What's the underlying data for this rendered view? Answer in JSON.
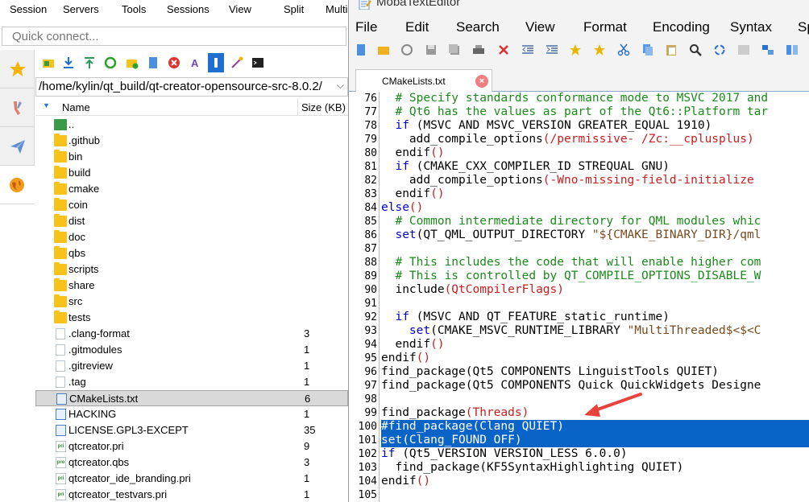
{
  "left": {
    "menu": [
      "Session",
      "Servers",
      "Tools",
      "Sessions",
      "View",
      "Split",
      "Multi"
    ],
    "quick_connect_placeholder": "Quick connect...",
    "path": "/home/kylin/qt_build/qt-creator-opensource-src-8.0.2/",
    "columns": {
      "name": "Name",
      "size": "Size (KB)"
    },
    "files": [
      {
        "name": "..",
        "size": "",
        "icon": "updir"
      },
      {
        "name": ".github",
        "size": "",
        "icon": "folder"
      },
      {
        "name": "bin",
        "size": "",
        "icon": "folder"
      },
      {
        "name": "build",
        "size": "",
        "icon": "folder"
      },
      {
        "name": "cmake",
        "size": "",
        "icon": "folder"
      },
      {
        "name": "coin",
        "size": "",
        "icon": "folder"
      },
      {
        "name": "dist",
        "size": "",
        "icon": "folder"
      },
      {
        "name": "doc",
        "size": "",
        "icon": "folder"
      },
      {
        "name": "qbs",
        "size": "",
        "icon": "folder"
      },
      {
        "name": "scripts",
        "size": "",
        "icon": "folder"
      },
      {
        "name": "share",
        "size": "",
        "icon": "folder"
      },
      {
        "name": "src",
        "size": "",
        "icon": "folder"
      },
      {
        "name": "tests",
        "size": "",
        "icon": "folder"
      },
      {
        "name": ".clang-format",
        "size": "3",
        "icon": "doc"
      },
      {
        "name": ".gitmodules",
        "size": "1",
        "icon": "doc"
      },
      {
        "name": ".gitreview",
        "size": "1",
        "icon": "doc"
      },
      {
        "name": ".tag",
        "size": "1",
        "icon": "doc"
      },
      {
        "name": "CMakeLists.txt",
        "size": "6",
        "icon": "doc-blue",
        "selected": true
      },
      {
        "name": "HACKING",
        "size": "1",
        "icon": "doc-blue"
      },
      {
        "name": "LICENSE.GPL3-EXCEPT",
        "size": "35",
        "icon": "doc-blue"
      },
      {
        "name": "qtcreator.pri",
        "size": "9",
        "icon": "pri"
      },
      {
        "name": "qtcreator.qbs",
        "size": "3",
        "icon": "pro"
      },
      {
        "name": "qtcreator_ide_branding.pri",
        "size": "1",
        "icon": "pri"
      },
      {
        "name": "qtcreator_testvars.pri",
        "size": "1",
        "icon": "pri"
      }
    ]
  },
  "editor": {
    "title": "MobaTextEditor",
    "menu": [
      "File",
      "Edit",
      "Search",
      "View",
      "Format",
      "Encoding",
      "Syntax",
      "Sp"
    ],
    "tab_label": "CMakeLists.txt",
    "tab_close": "×",
    "lines": [
      {
        "n": "76",
        "segs": [
          [
            "cm",
            "  # Specify standards conformance mode to MSVC 2017 and"
          ]
        ]
      },
      {
        "n": "77",
        "segs": [
          [
            "cm",
            "  # Qt6 has the values as part of the Qt6::Platform tar"
          ]
        ]
      },
      {
        "n": "78",
        "segs": [
          [
            "kw",
            "  if "
          ],
          [
            "id",
            "(MSVC AND MSVC_VERSION GREATER_EQUAL 1910)"
          ]
        ]
      },
      {
        "n": "79",
        "segs": [
          [
            "id",
            "    add_compile_options"
          ],
          [
            "pr",
            "(/permissive- /Zc:__cplusplus)"
          ]
        ]
      },
      {
        "n": "80",
        "segs": [
          [
            "id",
            "  endif"
          ],
          [
            "pr",
            "()"
          ]
        ]
      },
      {
        "n": "81",
        "segs": [
          [
            "kw",
            "  if "
          ],
          [
            "id",
            "(CMAKE_CXX_COMPILER_ID STREQUAL GNU)"
          ]
        ]
      },
      {
        "n": "82",
        "segs": [
          [
            "id",
            "    add_compile_options"
          ],
          [
            "pr",
            "(-Wno-missing-field-initialize"
          ]
        ]
      },
      {
        "n": "83",
        "segs": [
          [
            "id",
            "  endif"
          ],
          [
            "pr",
            "()"
          ]
        ]
      },
      {
        "n": "84",
        "segs": [
          [
            "kw",
            "else"
          ],
          [
            "pr",
            "()"
          ]
        ]
      },
      {
        "n": "85",
        "segs": [
          [
            "cm",
            "  # Common intermediate directory for QML modules whic"
          ]
        ]
      },
      {
        "n": "86",
        "segs": [
          [
            "kw",
            "  set"
          ],
          [
            "id",
            "(QT_QML_OUTPUT_DIRECTORY "
          ],
          [
            "st",
            "\"${CMAKE_BINARY_DIR}/qml"
          ]
        ]
      },
      {
        "n": "87",
        "segs": [
          [
            "id",
            ""
          ]
        ]
      },
      {
        "n": "88",
        "segs": [
          [
            "cm",
            "  # This includes the code that will enable higher com"
          ]
        ]
      },
      {
        "n": "89",
        "segs": [
          [
            "cm",
            "  # This is controlled by QT_COMPILE_OPTIONS_DISABLE_W"
          ]
        ]
      },
      {
        "n": "90",
        "segs": [
          [
            "id",
            "  include"
          ],
          [
            "pr",
            "(QtCompilerFlags)"
          ]
        ]
      },
      {
        "n": "91",
        "segs": [
          [
            "id",
            ""
          ]
        ]
      },
      {
        "n": "92",
        "segs": [
          [
            "kw",
            "  if "
          ],
          [
            "id",
            "(MSVC AND QT_FEATURE_static_runtime)"
          ]
        ]
      },
      {
        "n": "93",
        "segs": [
          [
            "kw",
            "    set"
          ],
          [
            "id",
            "(CMAKE_MSVC_RUNTIME_LIBRARY "
          ],
          [
            "st",
            "\"MultiThreaded$<$<C"
          ]
        ]
      },
      {
        "n": "94",
        "segs": [
          [
            "id",
            "  endif"
          ],
          [
            "pr",
            "()"
          ]
        ]
      },
      {
        "n": "95",
        "segs": [
          [
            "id",
            "endif"
          ],
          [
            "pr",
            "()"
          ]
        ]
      },
      {
        "n": "96",
        "segs": [
          [
            "id",
            "find_package"
          ],
          [
            "id",
            "(Qt5 COMPONENTS LinguistTools QUIET)"
          ]
        ]
      },
      {
        "n": "97",
        "segs": [
          [
            "id",
            "find_package"
          ],
          [
            "id",
            "(Qt5 COMPONENTS Quick QuickWidgets Designe"
          ]
        ]
      },
      {
        "n": "98",
        "segs": [
          [
            "id",
            ""
          ]
        ]
      },
      {
        "n": "99",
        "segs": [
          [
            "id",
            "find_package"
          ],
          [
            "pr",
            "(Threads)"
          ]
        ]
      },
      {
        "n": "100",
        "segs": [
          [
            "id",
            "#find_package(Clang QUIET)"
          ]
        ],
        "sel": true
      },
      {
        "n": "101",
        "segs": [
          [
            "id",
            "set(Clang_FOUND OFF)"
          ]
        ],
        "sel": true
      },
      {
        "n": "102",
        "segs": [
          [
            "kw",
            "if "
          ],
          [
            "id",
            "(Qt5_VERSION VERSION_LESS 6.0.0)"
          ]
        ]
      },
      {
        "n": "103",
        "segs": [
          [
            "id",
            "  find_package"
          ],
          [
            "id",
            "(KF5SyntaxHighlighting QUIET)"
          ]
        ]
      },
      {
        "n": "104",
        "segs": [
          [
            "id",
            "endif"
          ],
          [
            "pr",
            "()"
          ]
        ]
      },
      {
        "n": "105",
        "segs": [
          [
            "id",
            ""
          ]
        ]
      }
    ]
  },
  "colors": {
    "accent": "#0a64c8",
    "comment": "#1a8a1a",
    "keyword": "#0000c8",
    "paren": "#c81e1e",
    "arrow": "#e8423c"
  }
}
